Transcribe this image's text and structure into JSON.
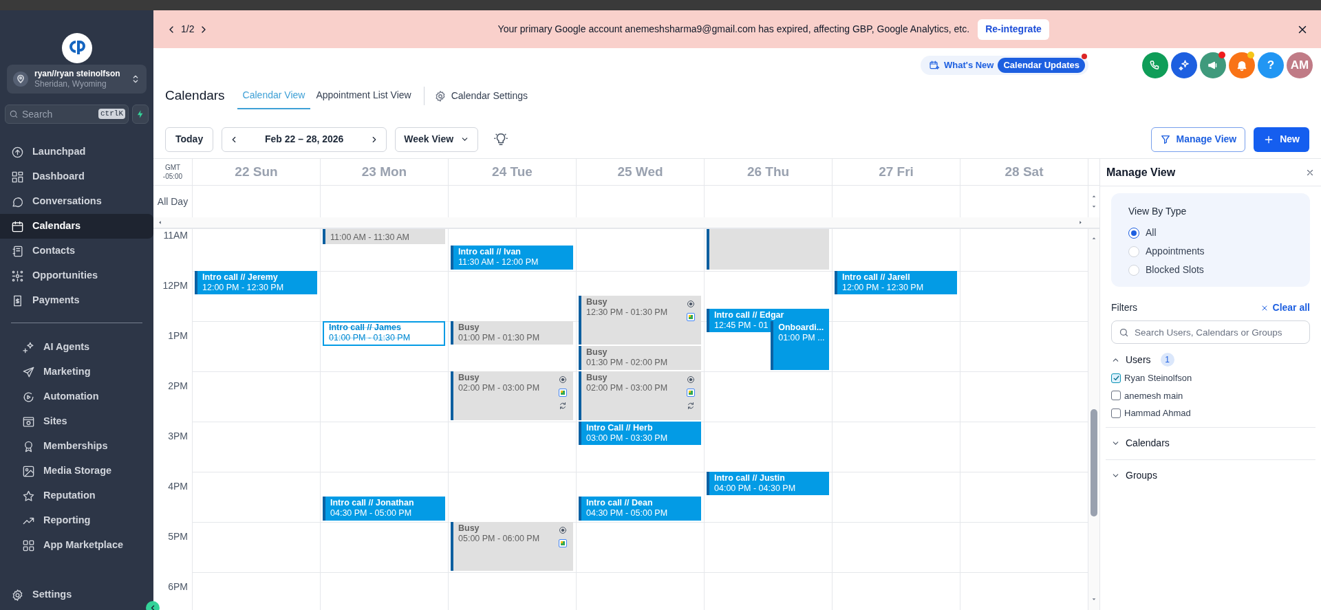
{
  "banner": {
    "pager": "1/2",
    "message": "Your primary Google account anemeshsharma9@gmail.com has expired, affecting GBP, Google Analytics, etc.",
    "action": "Re-integrate"
  },
  "sidebar": {
    "account": {
      "name": "ryan//ryan steinolfson",
      "location": "Sheridan, Wyoming"
    },
    "search": {
      "placeholder": "Search",
      "shortcut": "ctrlK"
    },
    "sections": [
      {
        "items": [
          {
            "label": "Launchpad",
            "selected": false
          },
          {
            "label": "Dashboard",
            "selected": false
          },
          {
            "label": "Conversations",
            "selected": false
          },
          {
            "label": "Calendars",
            "selected": true
          },
          {
            "label": "Contacts",
            "selected": false
          },
          {
            "label": "Opportunities",
            "selected": false
          },
          {
            "label": "Payments",
            "selected": false
          }
        ]
      },
      {
        "items": [
          {
            "label": "AI Agents",
            "selected": false
          },
          {
            "label": "Marketing",
            "selected": false
          },
          {
            "label": "Automation",
            "selected": false
          },
          {
            "label": "Sites",
            "selected": false
          },
          {
            "label": "Memberships",
            "selected": false
          },
          {
            "label": "Media Storage",
            "selected": false
          },
          {
            "label": "Reputation",
            "selected": false
          },
          {
            "label": "Reporting",
            "selected": false
          },
          {
            "label": "App Marketplace",
            "selected": false
          }
        ]
      }
    ],
    "settings": "Settings"
  },
  "header": {
    "whats_new": "What's New",
    "updates": "Calendar Updates",
    "updates_unread": true,
    "actions": [
      {
        "kind": "phone"
      },
      {
        "kind": "sparkle"
      },
      {
        "kind": "megaphone",
        "color": "#ef1c1c"
      },
      {
        "kind": "bell",
        "color": "#f5c518"
      },
      {
        "kind": "help",
        "label": "?"
      },
      {
        "kind": "avatar",
        "label": "AM"
      }
    ]
  },
  "page": {
    "title": "Calendars",
    "tabs": [
      {
        "label": "Calendar View",
        "selected": true
      },
      {
        "label": "Appointment List View",
        "selected": false
      }
    ],
    "settings": "Calendar Settings"
  },
  "toolbar": {
    "today": "Today",
    "range": "Feb 22 – 28, 2026",
    "view": "Week View",
    "manage": "Manage View",
    "new": "New"
  },
  "calendar": {
    "timezone": "GMT",
    "offset": "-05:00",
    "all_day": "All Day",
    "hours": [
      "11AM",
      "12PM",
      "1PM",
      "2PM",
      "3PM",
      "4PM",
      "5PM",
      "6PM"
    ],
    "days": [
      {
        "label": "22 Sun",
        "events": [
          {
            "kind": "appointment",
            "title": "Intro call // Jeremy",
            "time": "12:00 PM - 12:30 PM"
          }
        ]
      },
      {
        "label": "23 Mon",
        "events": [
          {
            "kind": "blocked",
            "time": "11:00 AM - 11:30 AM"
          },
          {
            "kind": "cancelled",
            "title": "Intro call // James",
            "time": "01:00 PM - 01:30 PM"
          },
          {
            "kind": "appointment",
            "title": "Intro call // Jonathan",
            "time": "04:30 PM - 05:00 PM"
          }
        ]
      },
      {
        "label": "24 Tue",
        "events": [
          {
            "kind": "appointment",
            "title": "Intro call // Ivan",
            "time": "11:30 AM - 12:00 PM"
          },
          {
            "kind": "blocked",
            "title": "Busy",
            "time": "01:00 PM - 01:30 PM"
          },
          {
            "kind": "blocked",
            "title": "Busy",
            "time": "02:00 PM - 03:00 PM",
            "synced": true,
            "recurring": true
          },
          {
            "kind": "blocked",
            "title": "Busy",
            "time": "05:00 PM - 06:00 PM",
            "synced": true
          }
        ]
      },
      {
        "label": "25 Wed",
        "events": [
          {
            "kind": "blocked",
            "title": "Busy",
            "time": "12:30 PM - 01:30 PM",
            "synced": true
          },
          {
            "kind": "blocked",
            "title": "Busy",
            "time": "01:30 PM - 02:00 PM"
          },
          {
            "kind": "blocked",
            "title": "Busy",
            "time": "02:00 PM - 03:00 PM",
            "synced": true,
            "recurring": true
          },
          {
            "kind": "appointment",
            "title": "Intro Call // Herb",
            "time": "03:00 PM - 03:30 PM"
          },
          {
            "kind": "appointment",
            "title": "Intro call // Dean",
            "time": "04:30 PM - 05:00 PM"
          }
        ]
      },
      {
        "label": "26 Thu",
        "events": [
          {
            "kind": "blocked",
            "continued": true
          },
          {
            "kind": "appointment",
            "title": "Intro call // Edgar",
            "time": "12:45 PM - 01"
          },
          {
            "kind": "appointment",
            "title": "Onboardi...",
            "time": "01:00 PM ...",
            "stacked": true
          },
          {
            "kind": "appointment",
            "title": "Intro call // Justin",
            "time": "04:00 PM - 04:30 PM"
          }
        ]
      },
      {
        "label": "27 Fri",
        "events": [
          {
            "kind": "appointment",
            "title": "Intro call // Jarell",
            "time": "12:00 PM - 12:30 PM"
          }
        ]
      },
      {
        "label": "28 Sat"
      }
    ]
  },
  "panel": {
    "title": "Manage View",
    "view_by": "View By Type",
    "types": [
      {
        "label": "All",
        "selected": true
      },
      {
        "label": "Appointments",
        "selected": false
      },
      {
        "label": "Blocked Slots",
        "selected": false
      }
    ],
    "filters": "Filters",
    "clear": "Clear all",
    "search_placeholder": "Search Users, Calendars or Groups",
    "groups": [
      {
        "label": "Users",
        "count": "1",
        "expanded": true,
        "options": [
          {
            "label": "Ryan Steinolfson",
            "checked": true
          },
          {
            "label": "anemesh main",
            "checked": false
          },
          {
            "label": "Hammad Ahmad",
            "checked": false
          }
        ]
      },
      {
        "label": "Calendars",
        "expanded": false
      },
      {
        "label": "Groups",
        "expanded": false
      }
    ]
  }
}
